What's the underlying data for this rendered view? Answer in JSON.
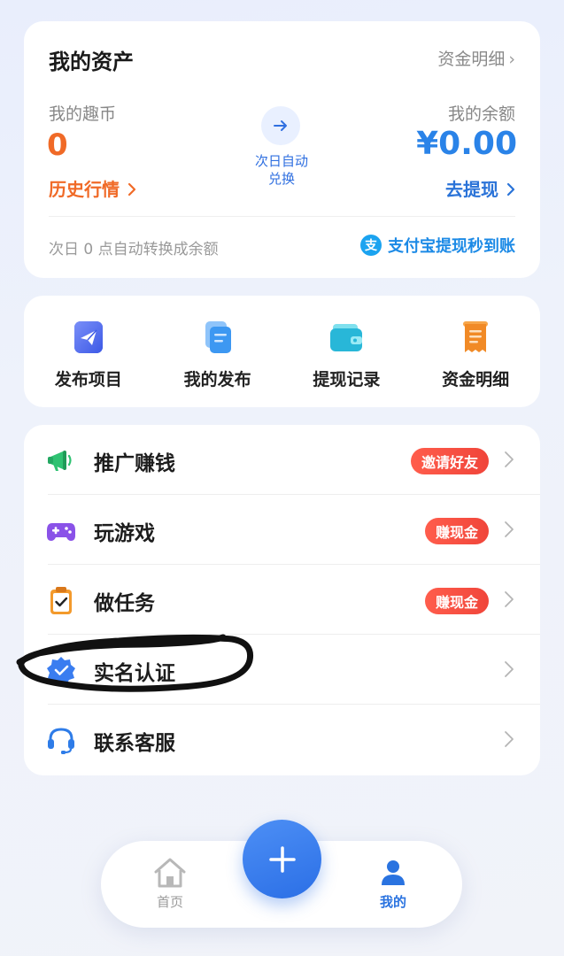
{
  "assets": {
    "title": "我的资产",
    "detail_link": "资金明细",
    "coin_label": "我的趣币",
    "coin_value": "0",
    "history_link": "历史行情",
    "exchange_text_line1": "次日自动",
    "exchange_text_line2": "兑换",
    "balance_label": "我的余额",
    "balance_value": "¥0.00",
    "withdraw_link": "去提现",
    "auto_note": "次日 0 点自动转换成余额",
    "alipay_icon_glyph": "支",
    "alipay_text": "支付宝提现秒到账"
  },
  "quick_actions": [
    {
      "label": "发布项目",
      "icon": "paper-plane-icon"
    },
    {
      "label": "我的发布",
      "icon": "documents-icon"
    },
    {
      "label": "提现记录",
      "icon": "wallet-icon"
    },
    {
      "label": "资金明细",
      "icon": "receipt-icon"
    }
  ],
  "menu": [
    {
      "label": "推广赚钱",
      "badge": "邀请好友",
      "icon": "megaphone-icon"
    },
    {
      "label": "玩游戏",
      "badge": "赚现金",
      "icon": "gamepad-icon"
    },
    {
      "label": "做任务",
      "badge": "赚现金",
      "icon": "clipboard-check-icon"
    },
    {
      "label": "实名认证",
      "badge": "",
      "icon": "verified-badge-icon"
    },
    {
      "label": "联系客服",
      "badge": "",
      "icon": "headset-icon"
    }
  ],
  "nav": {
    "home": "首页",
    "mine": "我的"
  },
  "colors": {
    "orange": "#f06a27",
    "blue": "#2a83e8",
    "badge_red": "#f0453a"
  }
}
